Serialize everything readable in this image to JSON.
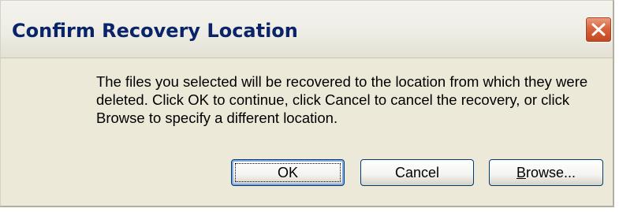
{
  "window": {
    "title": "Confirm Recovery Location",
    "close_icon": "close-x-icon"
  },
  "message": "The files you selected will be recovered to the location from which they were deleted. Click OK to continue, click Cancel to cancel the recovery, or click Browse to specify a different location.",
  "buttons": {
    "ok": "OK",
    "cancel": "Cancel",
    "browse_first": "B",
    "browse_rest": "rowse..."
  },
  "colors": {
    "title_text": "#0a246a",
    "dialog_face": "#ece9d8",
    "close_button": "#d9643c"
  }
}
